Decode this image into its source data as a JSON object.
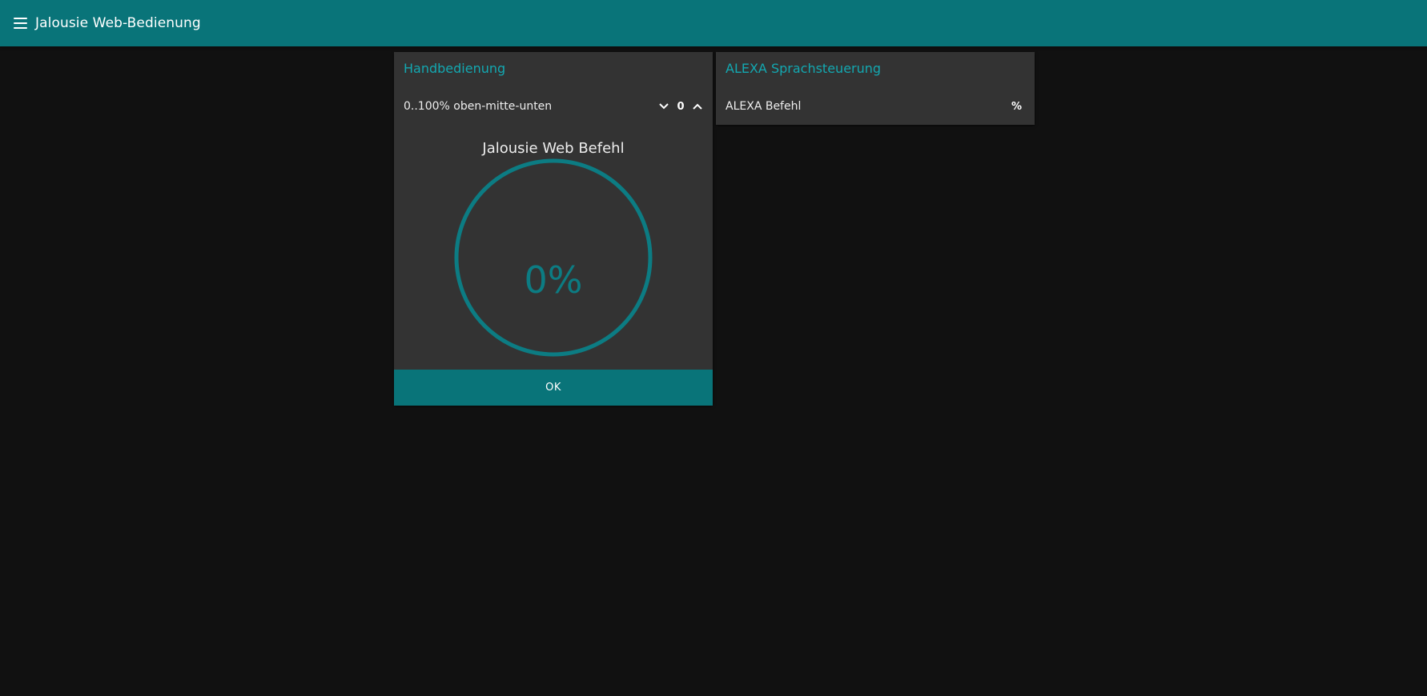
{
  "appbar": {
    "title": "Jalousie Web-Bedienung",
    "menu_icon": "hamburger-menu-icon",
    "color": "#097479"
  },
  "manual_card": {
    "title": "Handbedienung",
    "slider_label": "0..100% oben-mitte-unten",
    "stepper_value": "0",
    "decrement_icon": "chevron-down-icon",
    "increment_icon": "chevron-up-icon",
    "gauge_label": "Jalousie Web Befehl",
    "gauge_value_text": "0%",
    "gauge_percent": 0,
    "ok_label": "OK"
  },
  "alexa_card": {
    "title": "ALEXA Sprachsteuerung",
    "command_label": "ALEXA Befehl",
    "command_value": "%"
  },
  "colors": {
    "accent": "#13a8b1",
    "gauge_ring": "#0c7c83",
    "card": "#333333",
    "background": "#111111"
  }
}
